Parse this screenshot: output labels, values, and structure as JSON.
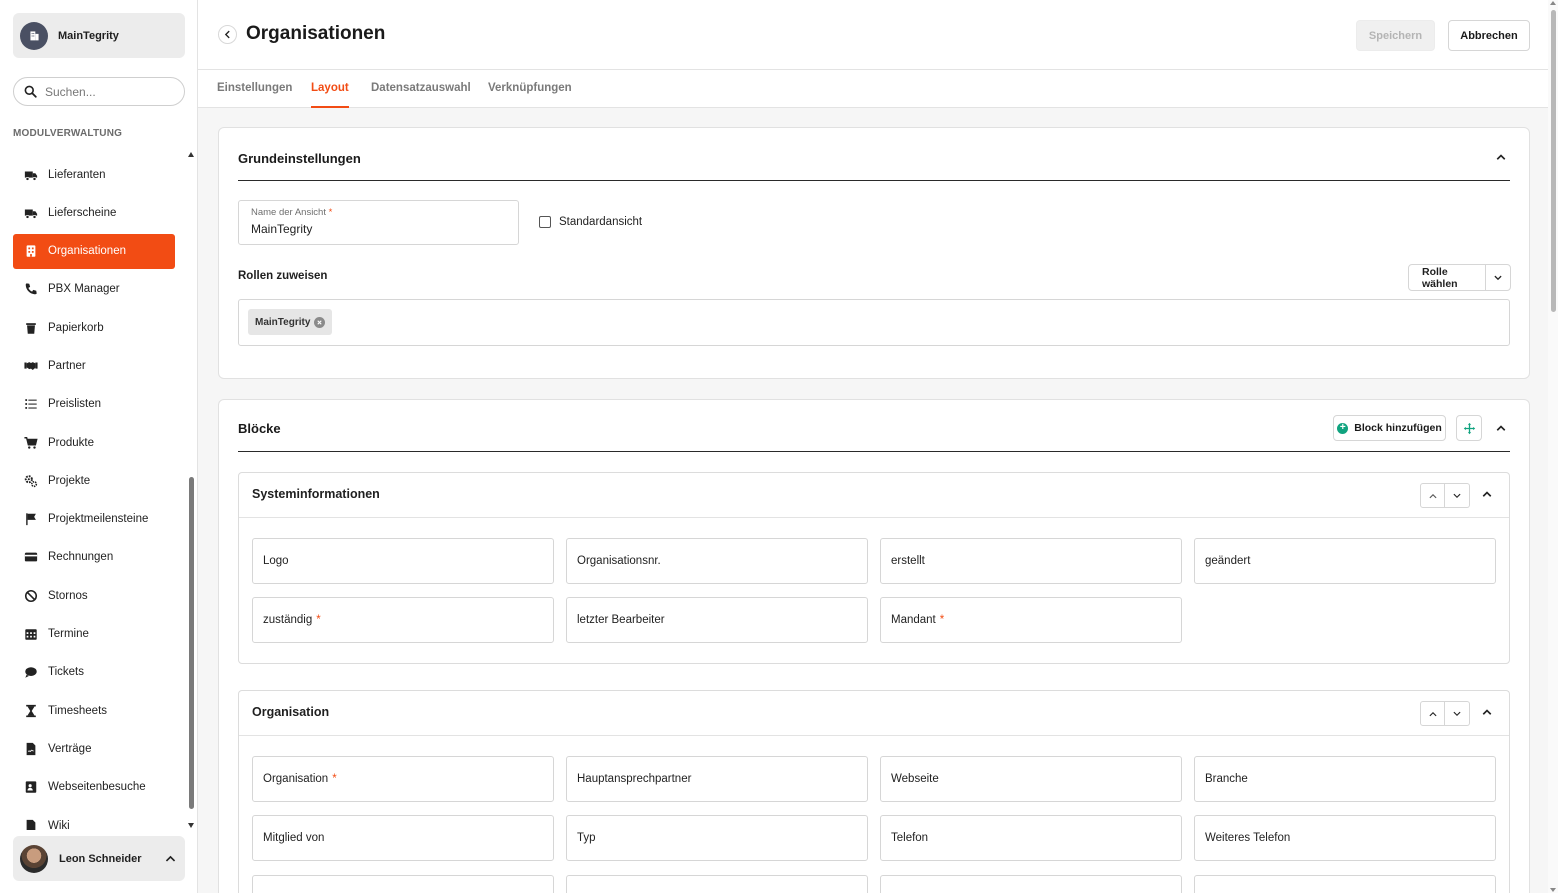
{
  "sidebar": {
    "org_name": "MainTegrity",
    "search_placeholder": "Suchen...",
    "section_label": "MODULVERWALTUNG",
    "items": [
      {
        "label": "Lieferanten",
        "icon": "truck-icon"
      },
      {
        "label": "Lieferscheine",
        "icon": "truck-icon"
      },
      {
        "label": "Organisationen",
        "icon": "building-icon",
        "active": true
      },
      {
        "label": "PBX Manager",
        "icon": "phone-icon"
      },
      {
        "label": "Papierkorb",
        "icon": "trash-icon"
      },
      {
        "label": "Partner",
        "icon": "handshake-icon"
      },
      {
        "label": "Preislisten",
        "icon": "list-icon"
      },
      {
        "label": "Produkte",
        "icon": "cart-icon"
      },
      {
        "label": "Projekte",
        "icon": "gears-icon"
      },
      {
        "label": "Projektmeilensteine",
        "icon": "flag-icon"
      },
      {
        "label": "Rechnungen",
        "icon": "credit-card-icon"
      },
      {
        "label": "Stornos",
        "icon": "ban-icon"
      },
      {
        "label": "Termine",
        "icon": "calendar-icon"
      },
      {
        "label": "Tickets",
        "icon": "comment-icon"
      },
      {
        "label": "Timesheets",
        "icon": "hourglass-icon"
      },
      {
        "label": "Verträge",
        "icon": "contract-icon"
      },
      {
        "label": "Webseitenbesuche",
        "icon": "id-card-icon"
      },
      {
        "label": "Wiki",
        "icon": "book-icon"
      }
    ],
    "user_name": "Leon Schneider"
  },
  "header": {
    "title": "Organisationen",
    "save_label": "Speichern",
    "cancel_label": "Abbrechen"
  },
  "tabs": [
    {
      "label": "Einstellungen"
    },
    {
      "label": "Layout",
      "active": true
    },
    {
      "label": "Datensatzauswahl"
    },
    {
      "label": "Verknüpfungen"
    }
  ],
  "grund": {
    "title": "Grundeinstellungen",
    "name_label": "Name der Ansicht",
    "name_required": "*",
    "name_value": "MainTegrity",
    "default_view_label": "Standardansicht",
    "roles_label": "Rollen zuweisen",
    "role_select_label": "Rolle wählen",
    "role_chip": "MainTegrity"
  },
  "bloecke": {
    "title": "Blöcke",
    "add_block_label": "Block hinzufügen",
    "sections": [
      {
        "title": "Systeminformationen",
        "fields": [
          {
            "label": "Logo",
            "req": ""
          },
          {
            "label": "Organisationsnr.",
            "req": ""
          },
          {
            "label": "erstellt",
            "req": ""
          },
          {
            "label": "geändert",
            "req": ""
          },
          {
            "label": "zuständig",
            "req": "*"
          },
          {
            "label": "letzter Bearbeiter",
            "req": ""
          },
          {
            "label": "Mandant",
            "req": "*"
          }
        ]
      },
      {
        "title": "Organisation",
        "fields": [
          {
            "label": "Organisation",
            "req": "*"
          },
          {
            "label": "Hauptansprechpartner",
            "req": ""
          },
          {
            "label": "Webseite",
            "req": ""
          },
          {
            "label": "Branche",
            "req": ""
          },
          {
            "label": "Mitglied von",
            "req": ""
          },
          {
            "label": "Typ",
            "req": ""
          },
          {
            "label": "Telefon",
            "req": ""
          },
          {
            "label": "Weiteres Telefon",
            "req": ""
          },
          {
            "label": "",
            "req": ""
          },
          {
            "label": "",
            "req": ""
          },
          {
            "label": "",
            "req": ""
          },
          {
            "label": "",
            "req": ""
          }
        ]
      }
    ]
  },
  "colors": {
    "accent": "#f24c14",
    "success": "#10a37f"
  }
}
